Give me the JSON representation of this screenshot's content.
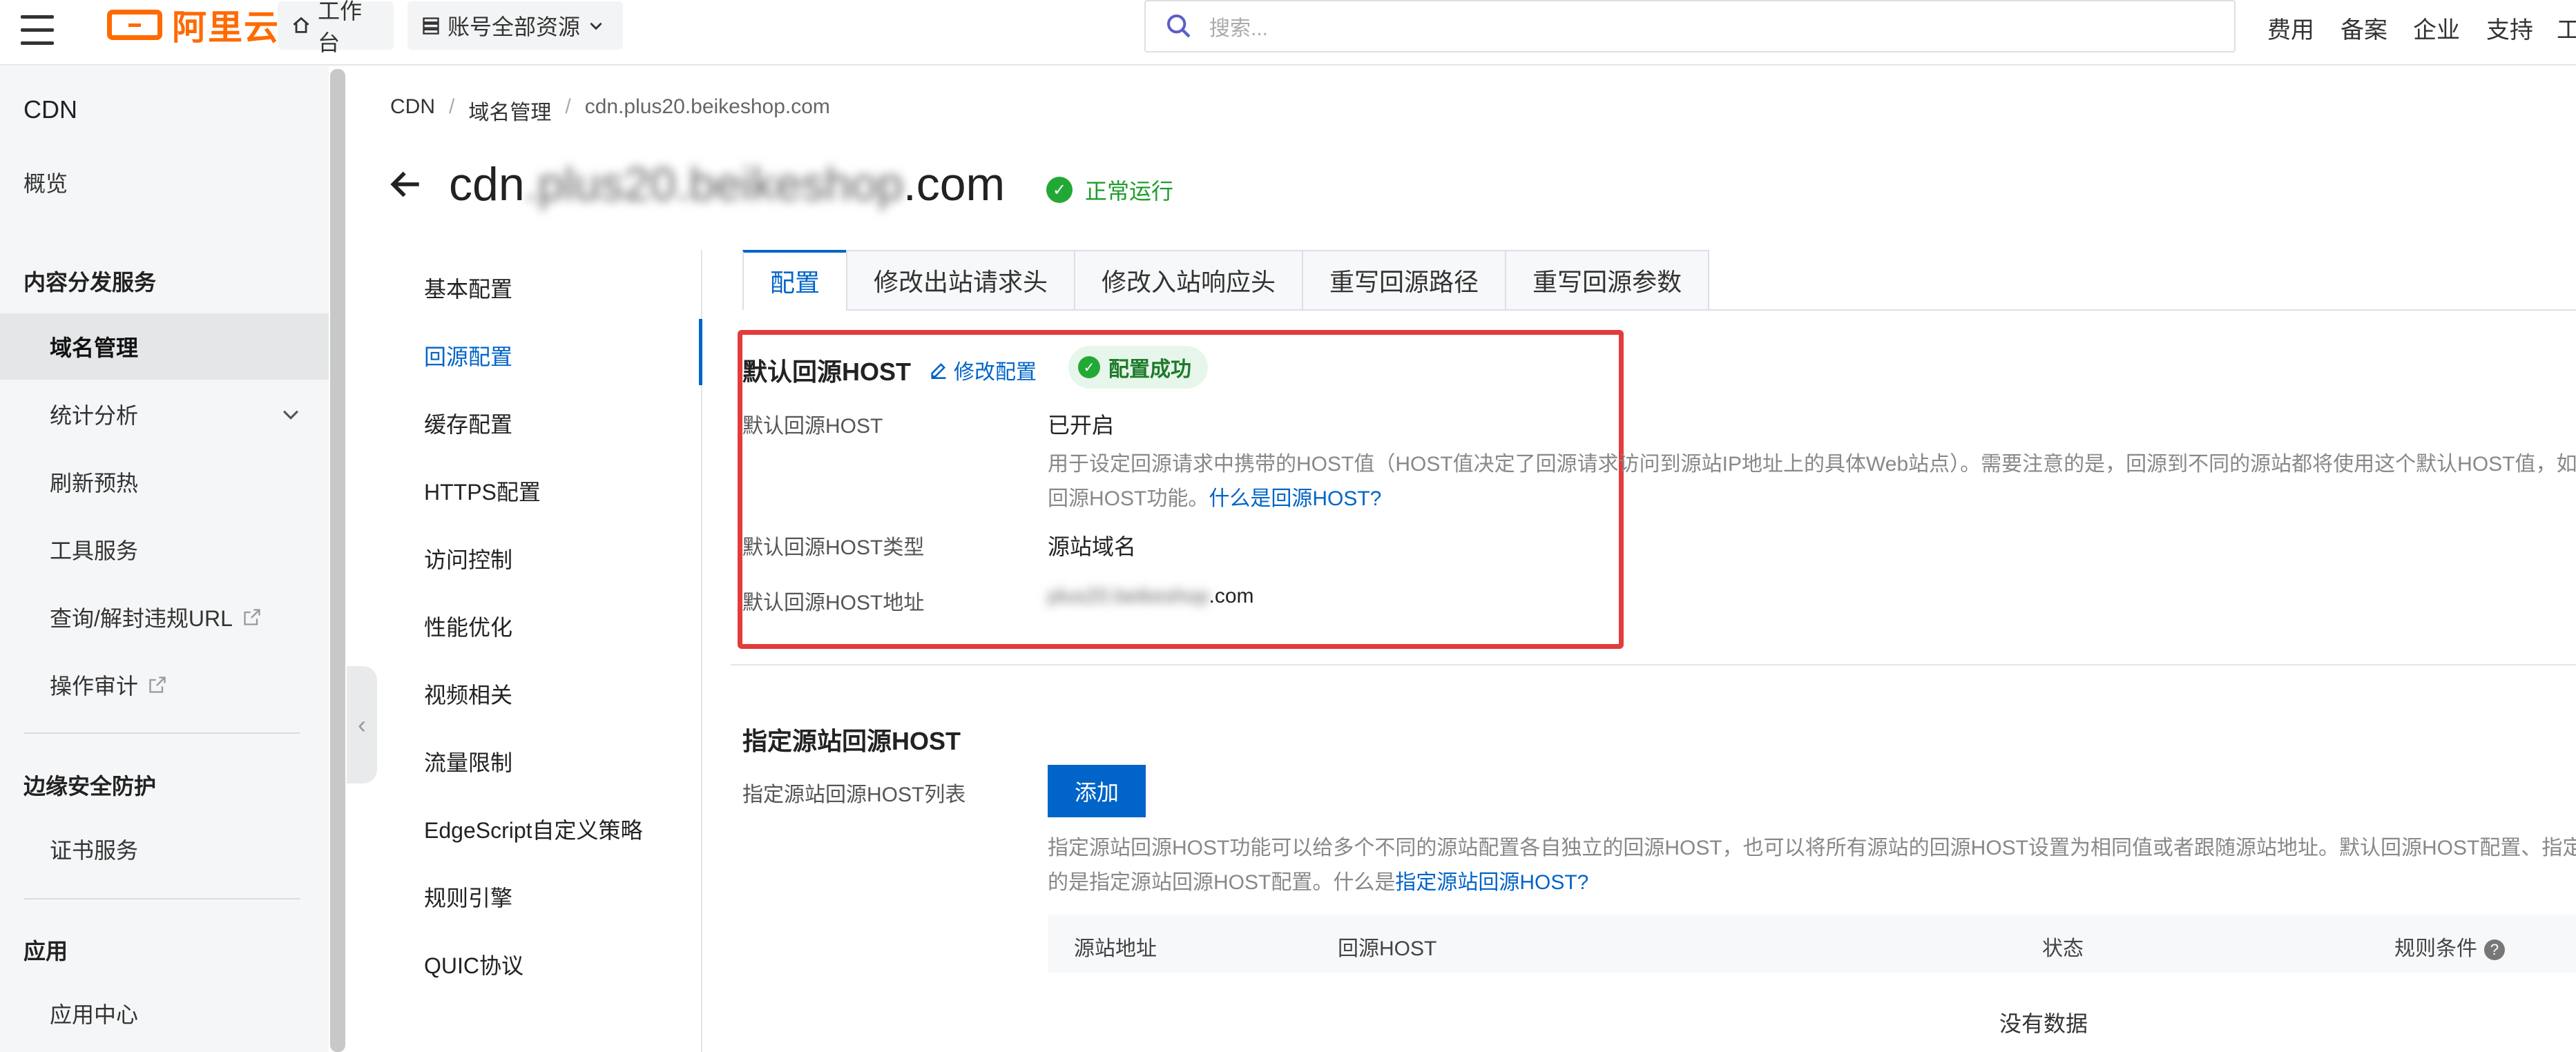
{
  "topbar": {
    "logo_text": "阿里云",
    "workbench": "工作台",
    "resources": "账号全部资源",
    "search_placeholder": "搜索...",
    "links": [
      "费用",
      "备案",
      "企业",
      "支持",
      "工"
    ]
  },
  "sidebar": {
    "product": "CDN",
    "overview": "概览",
    "group1": "内容分发服务",
    "group1_items": [
      "域名管理",
      "统计分析",
      "刷新预热",
      "工具服务",
      "查询/解封违规URL",
      "操作审计"
    ],
    "group2": "边缘安全防护",
    "group2_items": [
      "证书服务"
    ],
    "group3": "应用",
    "group3_items": [
      "应用中心"
    ]
  },
  "breadcrumb": [
    "CDN",
    "域名管理",
    "cdn.plus20.beikeshop.com"
  ],
  "page": {
    "title_prefix": "cdn",
    "title_blurred": ".plus20.beikeshop",
    "title_suffix": ".com",
    "status": "正常运行"
  },
  "subnav": [
    "基本配置",
    "回源配置",
    "缓存配置",
    "HTTPS配置",
    "访问控制",
    "性能优化",
    "视频相关",
    "流量限制",
    "EdgeScript自定义策略",
    "规则引擎",
    "QUIC协议"
  ],
  "tabs": [
    "配置",
    "修改出站请求头",
    "修改入站响应头",
    "重写回源路径",
    "重写回源参数"
  ],
  "default_host": {
    "title": "默认回源HOST",
    "edit": "修改配置",
    "badge": "配置成功",
    "row1_label": "默认回源HOST",
    "row1_value": "已开启",
    "help_line1": "用于设定回源请求中携带的HOST值（HOST值决定了回源请求访问到源站IP地址上的具体Web站点）。需要注意的是，回源到不同的源站都将使用这个默认HOST值，如果需",
    "help_line2_prefix": "回源HOST功能。",
    "help_link": "什么是回源HOST?",
    "row2_label": "默认回源HOST类型",
    "row2_value": "源站域名",
    "row3_label": "默认回源HOST地址",
    "row3_blurred": "plus20.beikeshop",
    "row3_suffix": ".com"
  },
  "specified_host": {
    "title": "指定源站回源HOST",
    "list_label": "指定源站回源HOST列表",
    "add": "添加",
    "help_line1": "指定源站回源HOST功能可以给多个不同的源站配置各自独立的回源HOST，也可以将所有源站的回源HOST设置为相同值或者跟随源站地址。默认回源HOST配置、指定源站",
    "help_line2_prefix": "的是指定源站回源HOST配置。什么是",
    "help_link": "指定源站回源HOST?",
    "columns": [
      "源站地址",
      "回源HOST",
      "状态",
      "规则条件"
    ],
    "empty": "没有数据"
  }
}
